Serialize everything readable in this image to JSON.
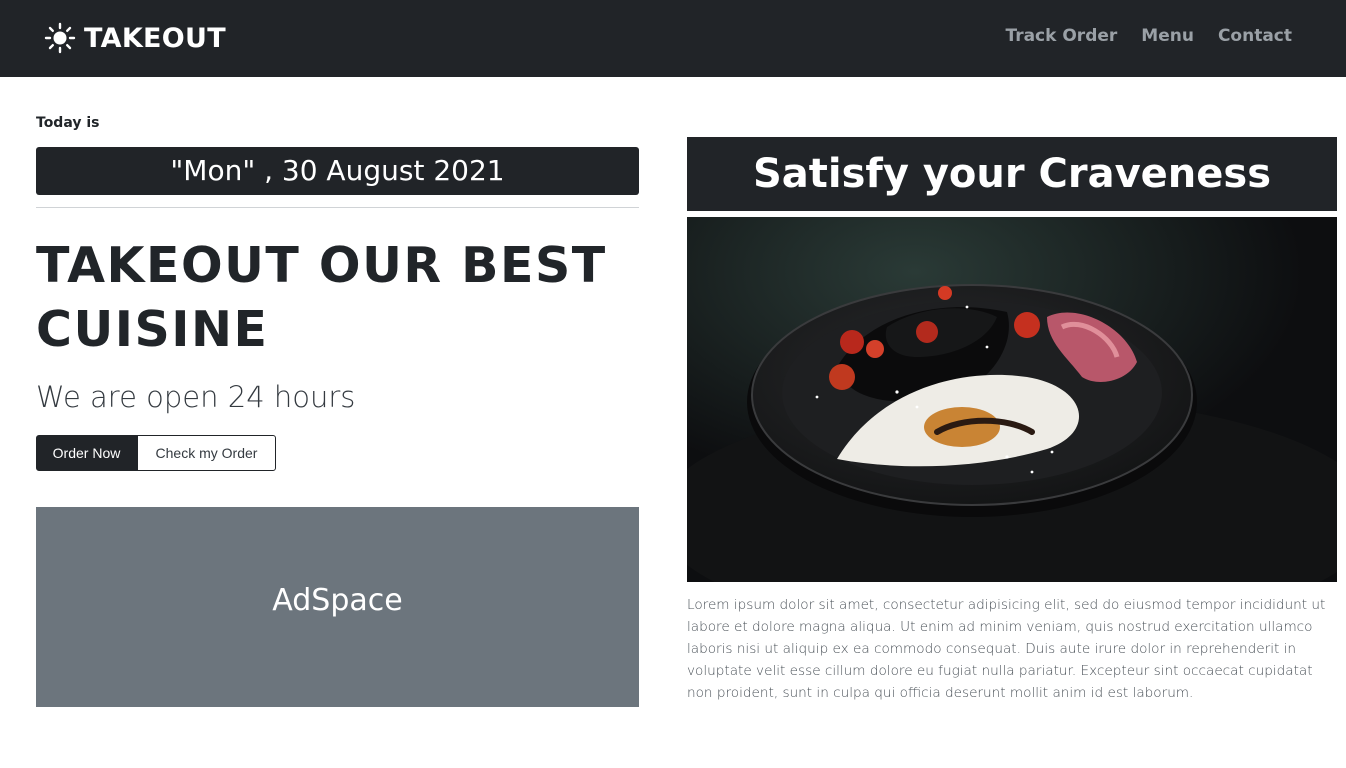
{
  "navbar": {
    "brand": "TAKEOUT",
    "brand_icon": "sun-icon",
    "links": [
      "Track Order",
      "Menu",
      "Contact"
    ]
  },
  "hero": {
    "today_label": "Today is",
    "date": "\"Mon\" , 30 August 2021",
    "headline": "TAKEOUT OUR BEST CUISINE",
    "open_hours": "We are open 24 hours",
    "order_button": "Order Now",
    "check_button": "Check my Order",
    "ad_label": "AdSpace"
  },
  "feature": {
    "title": "Satisfy your Craveness",
    "image_alt": "plate-of-food-photo",
    "description": "Lorem ipsum dolor sit amet, consectetur adipisicing elit, sed do eiusmod tempor incididunt ut labore et dolore magna aliqua. Ut enim ad minim veniam, quis nostrud exercitation ullamco laboris nisi ut aliquip ex ea commodo consequat. Duis aute irure dolor in reprehenderit in voluptate velit esse cillum dolore eu fugiat nulla pariatur. Excepteur sint occaecat cupidatat non proident, sunt in culpa qui officia deserunt mollit anim id est laborum."
  },
  "colors": {
    "navbar_bg": "#212428",
    "nav_link": "#9aa0a6",
    "ad_bg": "#6c757d"
  }
}
